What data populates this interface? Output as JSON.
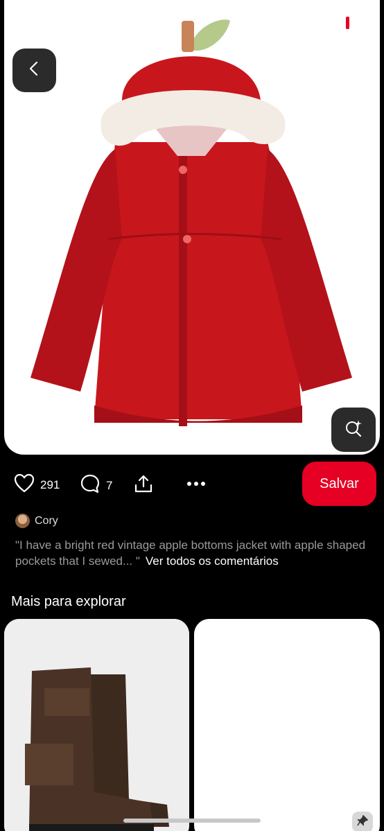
{
  "pin": {
    "likes": "291",
    "comments": "7",
    "save_label": "Salvar"
  },
  "comment": {
    "author": "Cory",
    "text": "\"I have a bright red vintage apple bottoms jacket with apple shaped pockets that I sewed... \"",
    "see_all": "Ver todos os comentários"
  },
  "explore": {
    "title": "Mais para explorar"
  },
  "colors": {
    "accent": "#e60023",
    "jacket": "#c8161d",
    "fur": "#f3ece4",
    "boot": "#4a3326"
  }
}
